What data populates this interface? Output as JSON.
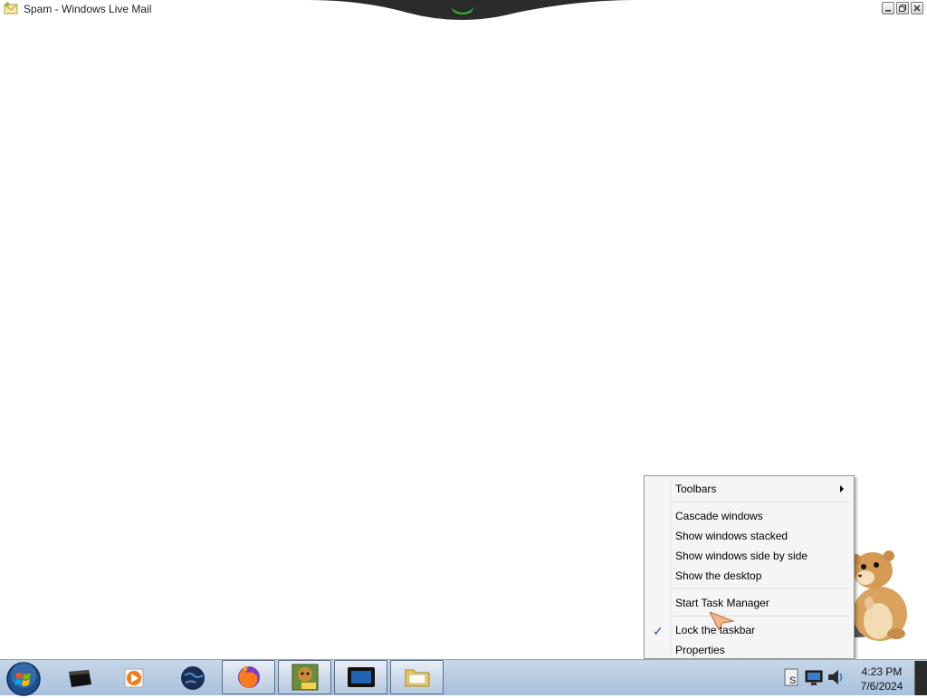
{
  "window": {
    "title": "Spam - Windows Live Mail",
    "title_icon": "windows-live-mail-icon",
    "controls": [
      "minimize-icon",
      "restore-icon",
      "close-icon"
    ]
  },
  "context_menu": {
    "items": [
      {
        "label": "Toolbars",
        "has_submenu": true
      },
      {
        "label": "Cascade windows"
      },
      {
        "label": "Show windows stacked"
      },
      {
        "label": "Show windows side by side"
      },
      {
        "label": "Show the desktop"
      },
      {
        "label": "Start Task Manager"
      },
      {
        "label": "Lock the taskbar",
        "checked": true
      },
      {
        "label": "Properties"
      }
    ]
  },
  "taskbar": {
    "start_icon": "windows-start-orb-icon",
    "pinned": [
      "media-center-icon",
      "media-player-icon",
      "globe-icon"
    ],
    "buttons": [
      "firefox-icon",
      "game-box-icon",
      "display-icon",
      "folder-icon"
    ],
    "tray_icons": [
      "action-center-icon",
      "network-icon",
      "volume-icon"
    ],
    "clock": {
      "time": "4:23 PM",
      "date": "7/6/2024"
    }
  },
  "colors": {
    "taskbar_top": "#c7d7ea",
    "taskbar_bottom": "#a8bfdc",
    "menu_bg": "#f5f5f5",
    "check": "#2a50a8"
  }
}
